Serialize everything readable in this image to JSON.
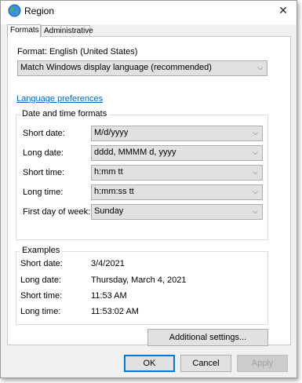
{
  "window": {
    "title": "Region",
    "close_glyph": "✕",
    "icon": "globe-icon"
  },
  "tabs": [
    {
      "label": "Formats",
      "active": true
    },
    {
      "label": "Administrative",
      "active": false
    }
  ],
  "format": {
    "label": "Format: English (United States)",
    "value": "Match Windows display language (recommended)"
  },
  "language_link": "Language preferences",
  "datetime_group": {
    "title": "Date and time formats",
    "rows": [
      {
        "label": "Short date:",
        "value": "M/d/yyyy"
      },
      {
        "label": "Long date:",
        "value": "dddd, MMMM d, yyyy"
      },
      {
        "label": "Short time:",
        "value": "h:mm tt"
      },
      {
        "label": "Long time:",
        "value": "h:mm:ss tt"
      },
      {
        "label": "First day of week:",
        "value": "Sunday"
      }
    ]
  },
  "examples_group": {
    "title": "Examples",
    "rows": [
      {
        "label": "Short date:",
        "value": "3/4/2021"
      },
      {
        "label": "Long date:",
        "value": "Thursday, March 4, 2021"
      },
      {
        "label": "Short time:",
        "value": "11:53 AM"
      },
      {
        "label": "Long time:",
        "value": "11:53:02 AM"
      }
    ]
  },
  "buttons": {
    "additional": "Additional settings...",
    "ok": "OK",
    "cancel": "Cancel",
    "apply": "Apply"
  },
  "chevron_glyph": "⌵",
  "colors": {
    "link": "#0066cc",
    "primary_border": "#0078d7",
    "button_bg": "#e1e1e1"
  }
}
